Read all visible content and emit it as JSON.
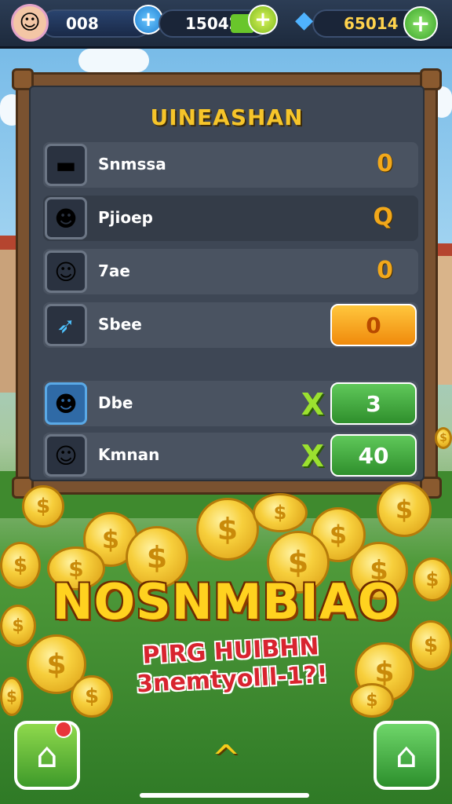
{
  "topbar": {
    "level": "008",
    "coins": "15042",
    "gems": "65014",
    "plus": "+"
  },
  "panel": {
    "title": "UINEASHAN",
    "rows": [
      {
        "name": "Snmssa",
        "value": "0",
        "icon": "gold-bar-icon"
      },
      {
        "name": "Pjioep",
        "value": "Q",
        "icon": "boy-avatar-icon"
      },
      {
        "name": "7ae",
        "value": "0",
        "icon": "girl-avatar-icon"
      },
      {
        "name": "Sbee",
        "button": "0",
        "icon": "feather-icon"
      },
      {
        "name": "Dbe",
        "mark": "X",
        "button": "3",
        "icon": "pink-hat-avatar-icon"
      },
      {
        "name": "Kmnan",
        "mark": "X",
        "button": "40",
        "icon": "blonde-avatar-icon"
      }
    ]
  },
  "banner": {
    "title": "NOSNMBIAO",
    "subtitle_line1": "PIRG HUIBHN",
    "subtitle_line2": "3nemtyolll-1?!"
  },
  "coin_symbol": "$",
  "nav": {
    "up_arrow": "^"
  }
}
